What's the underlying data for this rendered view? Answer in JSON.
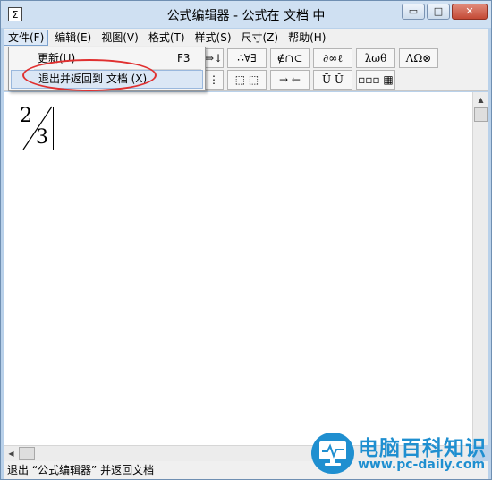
{
  "window": {
    "title": "公式编辑器 - 公式在 文档  中",
    "app_icon_glyph": "Σ",
    "min_glyph": "▭",
    "max_glyph": "□",
    "close_glyph": "✕"
  },
  "menu": {
    "items": [
      "文件(F)",
      "编辑(E)",
      "视图(V)",
      "格式(T)",
      "样式(S)",
      "尺寸(Z)",
      "帮助(H)"
    ],
    "active_index": 0
  },
  "dropdown": {
    "items": [
      {
        "label": "更新(U)",
        "shortcut": "F3"
      },
      {
        "label": "退出并返回到 文档 (X)",
        "shortcut": ""
      }
    ],
    "highlight_color": "#e03030"
  },
  "toolbar": {
    "row1": [
      "⇒↓",
      "∴∀∃",
      "∉∩⊂",
      "∂∞ℓ",
      "λωθ",
      "ΛΩ⊗"
    ],
    "row2": [
      "⋮",
      "⬚ ⬚",
      "→ ←",
      "Ū Ŭ",
      "▫▫▫ ▦"
    ]
  },
  "editor": {
    "numerator": "2",
    "denominator": "3"
  },
  "scrollbars": {
    "up_arrow": "▲",
    "left_arrow": "◀"
  },
  "status": {
    "text": "退出 “公式编辑器” 并返回文档"
  },
  "watermark": {
    "title": "电脑百科知识",
    "url": "www.pc-daily.com",
    "color": "#1f8fd0"
  }
}
